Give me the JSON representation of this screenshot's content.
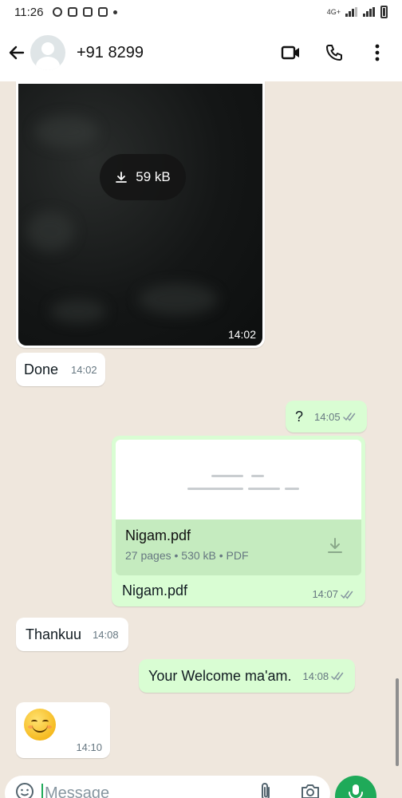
{
  "status_bar": {
    "time": "11:26",
    "network": "4G+"
  },
  "header": {
    "contact": "+91 8299"
  },
  "messages": {
    "image": {
      "size": "59 kB",
      "time": "14:02"
    },
    "done": {
      "text": "Done",
      "time": "14:02"
    },
    "question": {
      "text": "?",
      "time": "14:05"
    },
    "pdf": {
      "filename": "Nigam.pdf",
      "details": "27 pages • 530 kB • PDF",
      "caption": "Nigam.pdf",
      "time": "14:07"
    },
    "thankuu": {
      "text": "Thankuu",
      "time": "14:08"
    },
    "welcome": {
      "text": "Your Welcome ma'am.",
      "time": "14:08"
    },
    "emoji": {
      "time": "14:10"
    }
  },
  "input": {
    "placeholder": "Message"
  },
  "colors": {
    "accent": "#1faa59",
    "outgoing": "#d9fdd3",
    "incoming": "#ffffff",
    "wallpaper": "#efe7dd"
  }
}
